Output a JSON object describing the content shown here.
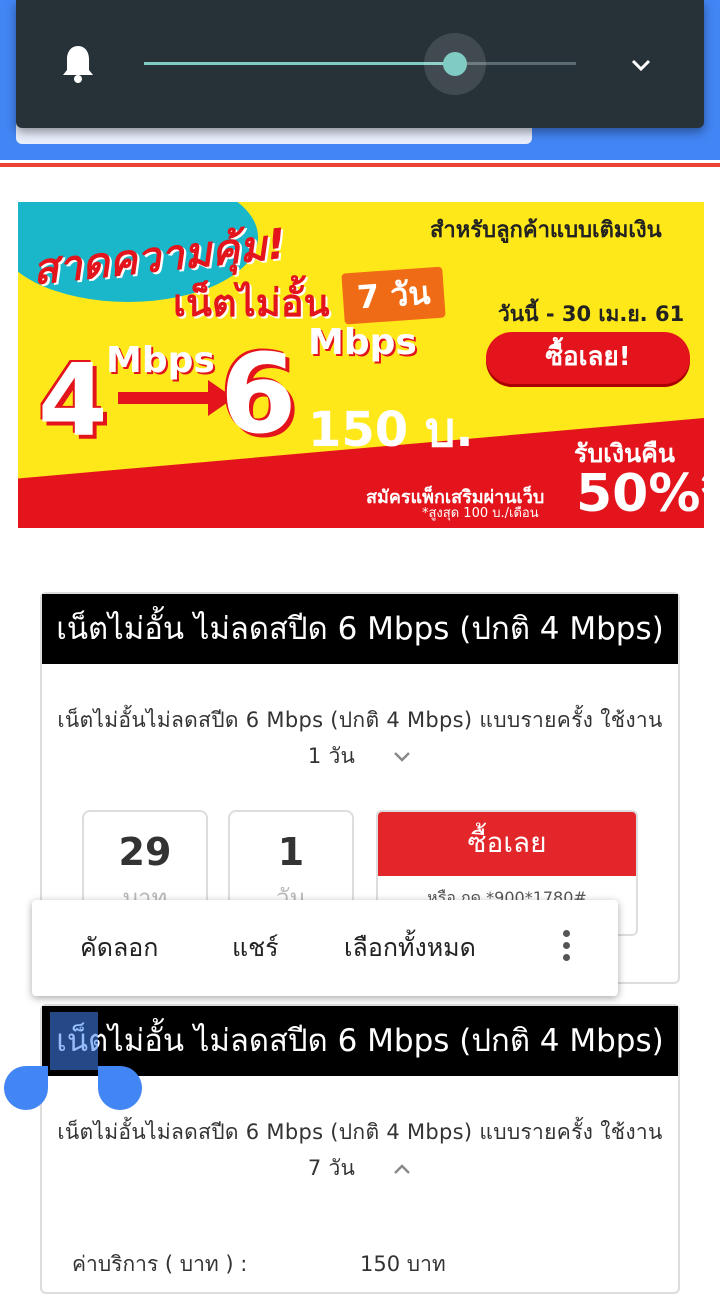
{
  "banner": {
    "headline": "สาดความคุ้ม!",
    "audience": "สำหรับลูกค้าแบบเติมเงิน",
    "unlimited": "เน็ตไม่อั้น",
    "days": "7 วัน",
    "from_speed": "4",
    "from_unit": "Mbps",
    "to_speed": "6",
    "to_unit": "Mbps",
    "price": "150 บ.",
    "period": "วันนี้ - 30 เม.ย. 61",
    "buy": "ซื้อเลย!",
    "cashback": "รับเงินคืน",
    "cashback_note": "สมัครแพ็กเสริมผ่านเว็บ",
    "cashback_limit": "*สูงสุด 100 บ./เดือน",
    "cashback_pct": "50%*"
  },
  "card1": {
    "title": "เน็ตไม่อั้น ไม่ลดสปีด 6 Mbps (ปกติ 4 Mbps)",
    "desc": "เน็ตไม่อั้นไม่ลดสปีด 6 Mbps (ปกติ 4 Mbps) แบบรายครั้ง ใช้งาน",
    "desc2": "1 วัน",
    "price": "29",
    "price_unit": "บาท",
    "duration": "1",
    "duration_unit": "วัน",
    "buy": "ซื้อเลย",
    "ussd": "หรือ กด *900*1780#"
  },
  "card2": {
    "title": "เน็ตไม่อั้น ไม่ลดสปีด 6 Mbps (ปกติ 4 Mbps)",
    "desc": "เน็ตไม่อั้นไม่ลดสปีด 6 Mbps (ปกติ 4 Mbps) แบบรายครั้ง ใช้งาน",
    "desc2": "7 วัน",
    "fee_label": "ค่าบริการ ( บาท ) :",
    "fee_value": "150 บาท"
  },
  "context_menu": {
    "copy": "คัดลอก",
    "share": "แชร์",
    "select_all": "เลือกทั้งหมด",
    "more_icon": "more-vert-icon"
  },
  "volume": {
    "level": 0.72,
    "icon": "bell-icon"
  },
  "colors": {
    "blue": "#4285f4",
    "red": "#e3262a",
    "teal": "#80cbc4"
  }
}
